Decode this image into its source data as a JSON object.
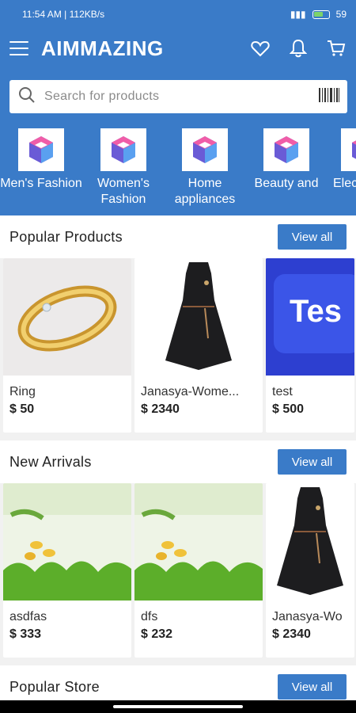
{
  "status": {
    "time": "11:54 AM",
    "speed": "112KB/s",
    "battery": "59"
  },
  "header": {
    "logo": "AIMMAZING",
    "search_placeholder": "Search for products"
  },
  "categories": [
    {
      "label": "Men's Fashion"
    },
    {
      "label": "Women's Fashion"
    },
    {
      "label": "Home appliances"
    },
    {
      "label": "Beauty and"
    },
    {
      "label": "Elec"
    }
  ],
  "sections": {
    "popular_products": {
      "title": "Popular Products",
      "view_all": "View all",
      "items": [
        {
          "name": "Ring",
          "price": "$ 50"
        },
        {
          "name": "Janasya-Wome...",
          "price": "$ 2340"
        },
        {
          "name": "test",
          "price": "$ 500"
        }
      ]
    },
    "new_arrivals": {
      "title": "New Arrivals",
      "view_all": "View all",
      "items": [
        {
          "name": "asdfas",
          "price": "$ 333"
        },
        {
          "name": "dfs",
          "price": "$ 232"
        },
        {
          "name": "Janasya-Wo",
          "price": "$ 2340"
        }
      ]
    },
    "popular_store": {
      "title": "Popular Store",
      "view_all": "View all"
    }
  },
  "icons": {
    "menu": "menu-icon",
    "wishlist": "heart-icon",
    "notifications": "bell-icon",
    "cart": "cart-icon",
    "search": "search-icon",
    "barcode": "barcode-icon"
  },
  "colors": {
    "primary": "#3a7bc8",
    "background": "#f1f1f1"
  }
}
